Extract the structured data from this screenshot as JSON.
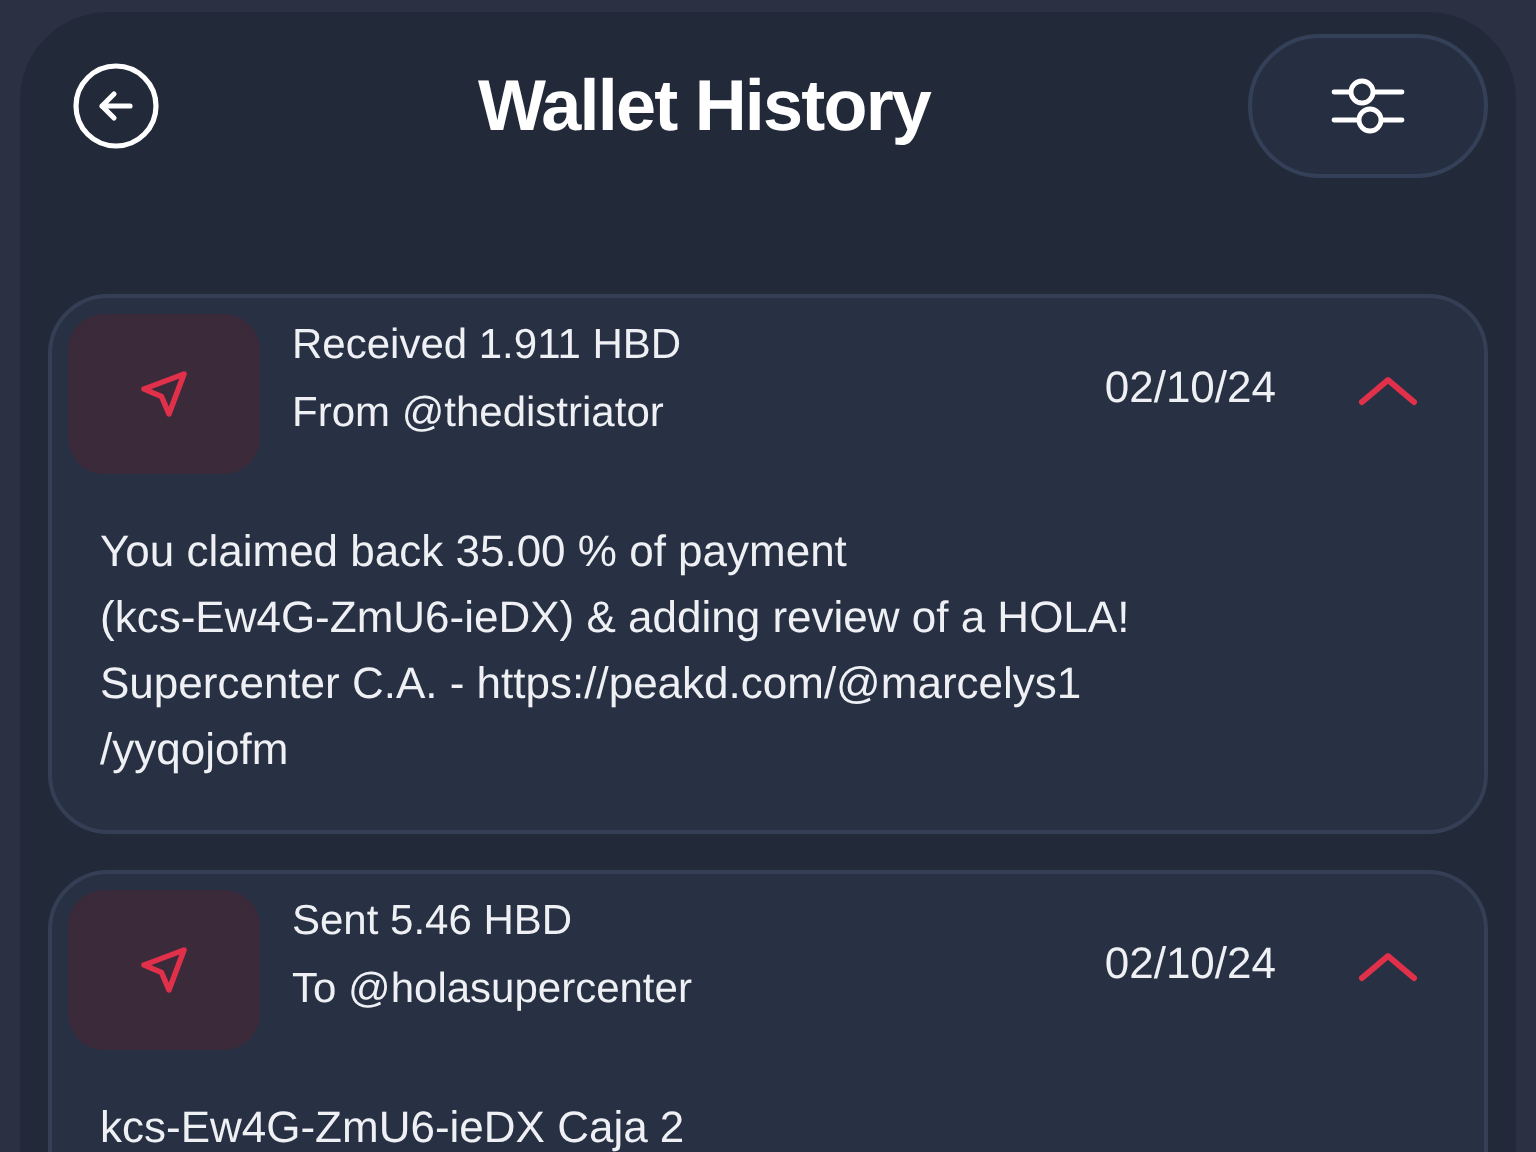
{
  "header": {
    "title": "Wallet History"
  },
  "transactions": [
    {
      "title": "Received 1.911 HBD",
      "counterparty": "From @thedistriator",
      "date": "02/10/24",
      "expanded": true,
      "memo_lines": [
        "You claimed back 35.00 % of payment",
        "(kcs-Ew4G-ZmU6-ieDX) & adding review of a HOLA!",
        "Supercenter C.A. - https://peakd.com/@marcelys1",
        "/yyqojofm"
      ]
    },
    {
      "title": "Sent 5.46 HBD",
      "counterparty": "To @holasupercenter",
      "date": "02/10/24",
      "expanded": true,
      "memo_lines": [
        "kcs-Ew4G-ZmU6-ieDX Caja 2"
      ]
    }
  ]
}
